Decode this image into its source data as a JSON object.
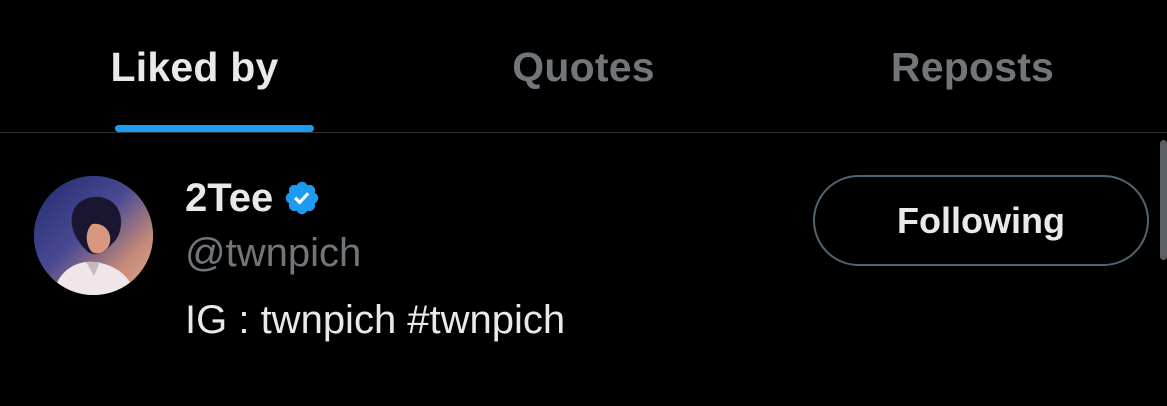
{
  "tabs": [
    {
      "label": "Liked by",
      "active": true
    },
    {
      "label": "Quotes",
      "active": false
    },
    {
      "label": "Reposts",
      "active": false
    }
  ],
  "user": {
    "display_name": "2Tee",
    "verified_icon": "verified-badge-icon",
    "handle": "@twnpich",
    "bio": "IG : twnpich #twnpich",
    "follow_button_label": "Following"
  },
  "colors": {
    "background": "#000000",
    "primary_text": "#e7e9ea",
    "secondary_text": "#71767b",
    "accent": "#1d9bf0",
    "divider": "#2f3336"
  }
}
